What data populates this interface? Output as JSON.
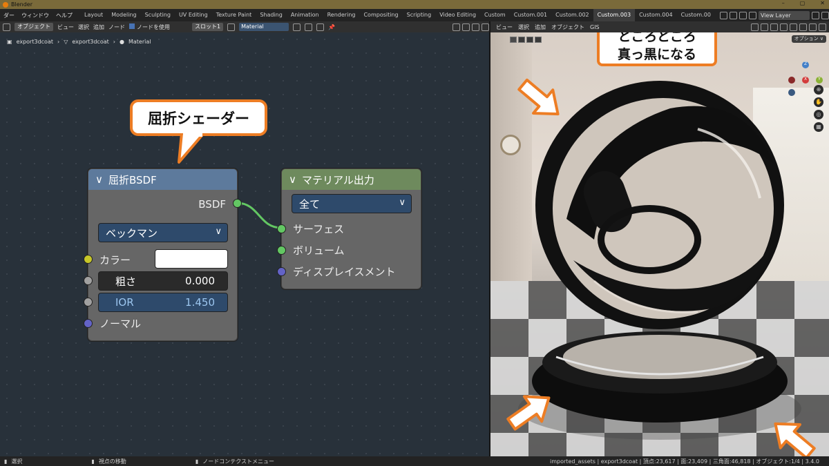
{
  "window": {
    "title": "Blender"
  },
  "menu": {
    "items": [
      "ダー",
      "ウィンドウ",
      "ヘルプ"
    ],
    "workspaces": [
      "Layout",
      "Modeling",
      "Sculpting",
      "UV Editing",
      "Texture Paint",
      "Shading",
      "Animation",
      "Rendering",
      "Compositing",
      "Scripting",
      "Video Editing",
      "Custom",
      "Custom.001",
      "Custom.002",
      "Custom.003",
      "Custom.004",
      "Custom.00"
    ],
    "view_layer": "View Layer"
  },
  "node_header": {
    "mode": "オブジェクト",
    "view": "ビュー",
    "select": "選択",
    "add": "追加",
    "node": "ノード",
    "use_nodes": "ノードを使用",
    "slot": "スロット1",
    "material": "Material"
  },
  "breadcrumb": [
    "export3dcoat",
    "export3dcoat",
    "Material"
  ],
  "refraction_node": {
    "title": "屈折BSDF",
    "output": "BSDF",
    "distribution": "ベックマン",
    "color_label": "カラー",
    "roughness_label": "粗さ",
    "roughness": "0.000",
    "ior_label": "IOR",
    "ior": "1.450",
    "normal_label": "ノーマル"
  },
  "output_node": {
    "title": "マテリアル出力",
    "target": "全て",
    "surface": "サーフェス",
    "volume": "ボリューム",
    "displacement": "ディスプレイスメント"
  },
  "callouts": {
    "shader": "屈折シェーダー",
    "viewport": [
      "ところどころ",
      "真っ黒になる"
    ]
  },
  "viewport_header": {
    "items": [
      "ビュー",
      "選択",
      "追加",
      "オブジェクト",
      "GIS"
    ],
    "options": "オプション"
  },
  "gizmo": {
    "z": "Z",
    "y": "Y",
    "x": "X"
  },
  "status": {
    "select": "選択",
    "move": "視点の移動",
    "context": "ノードコンテクストメニュー",
    "info": "imported_assets | export3dcoat | 頂点:23,617 | 面:23,409 | 三角面:46,818 | オブジェクト:1/4 | 3.4.0"
  },
  "colors": {
    "accent": "#ed7d24",
    "socket_yellow": "#c7c729",
    "socket_grey": "#a1a1a1",
    "socket_green": "#63c763",
    "socket_blue": "#6363c7",
    "node_header_blue": "#5d7a9c",
    "node_header_green": "#6e8a5d",
    "link": "#63c763"
  }
}
